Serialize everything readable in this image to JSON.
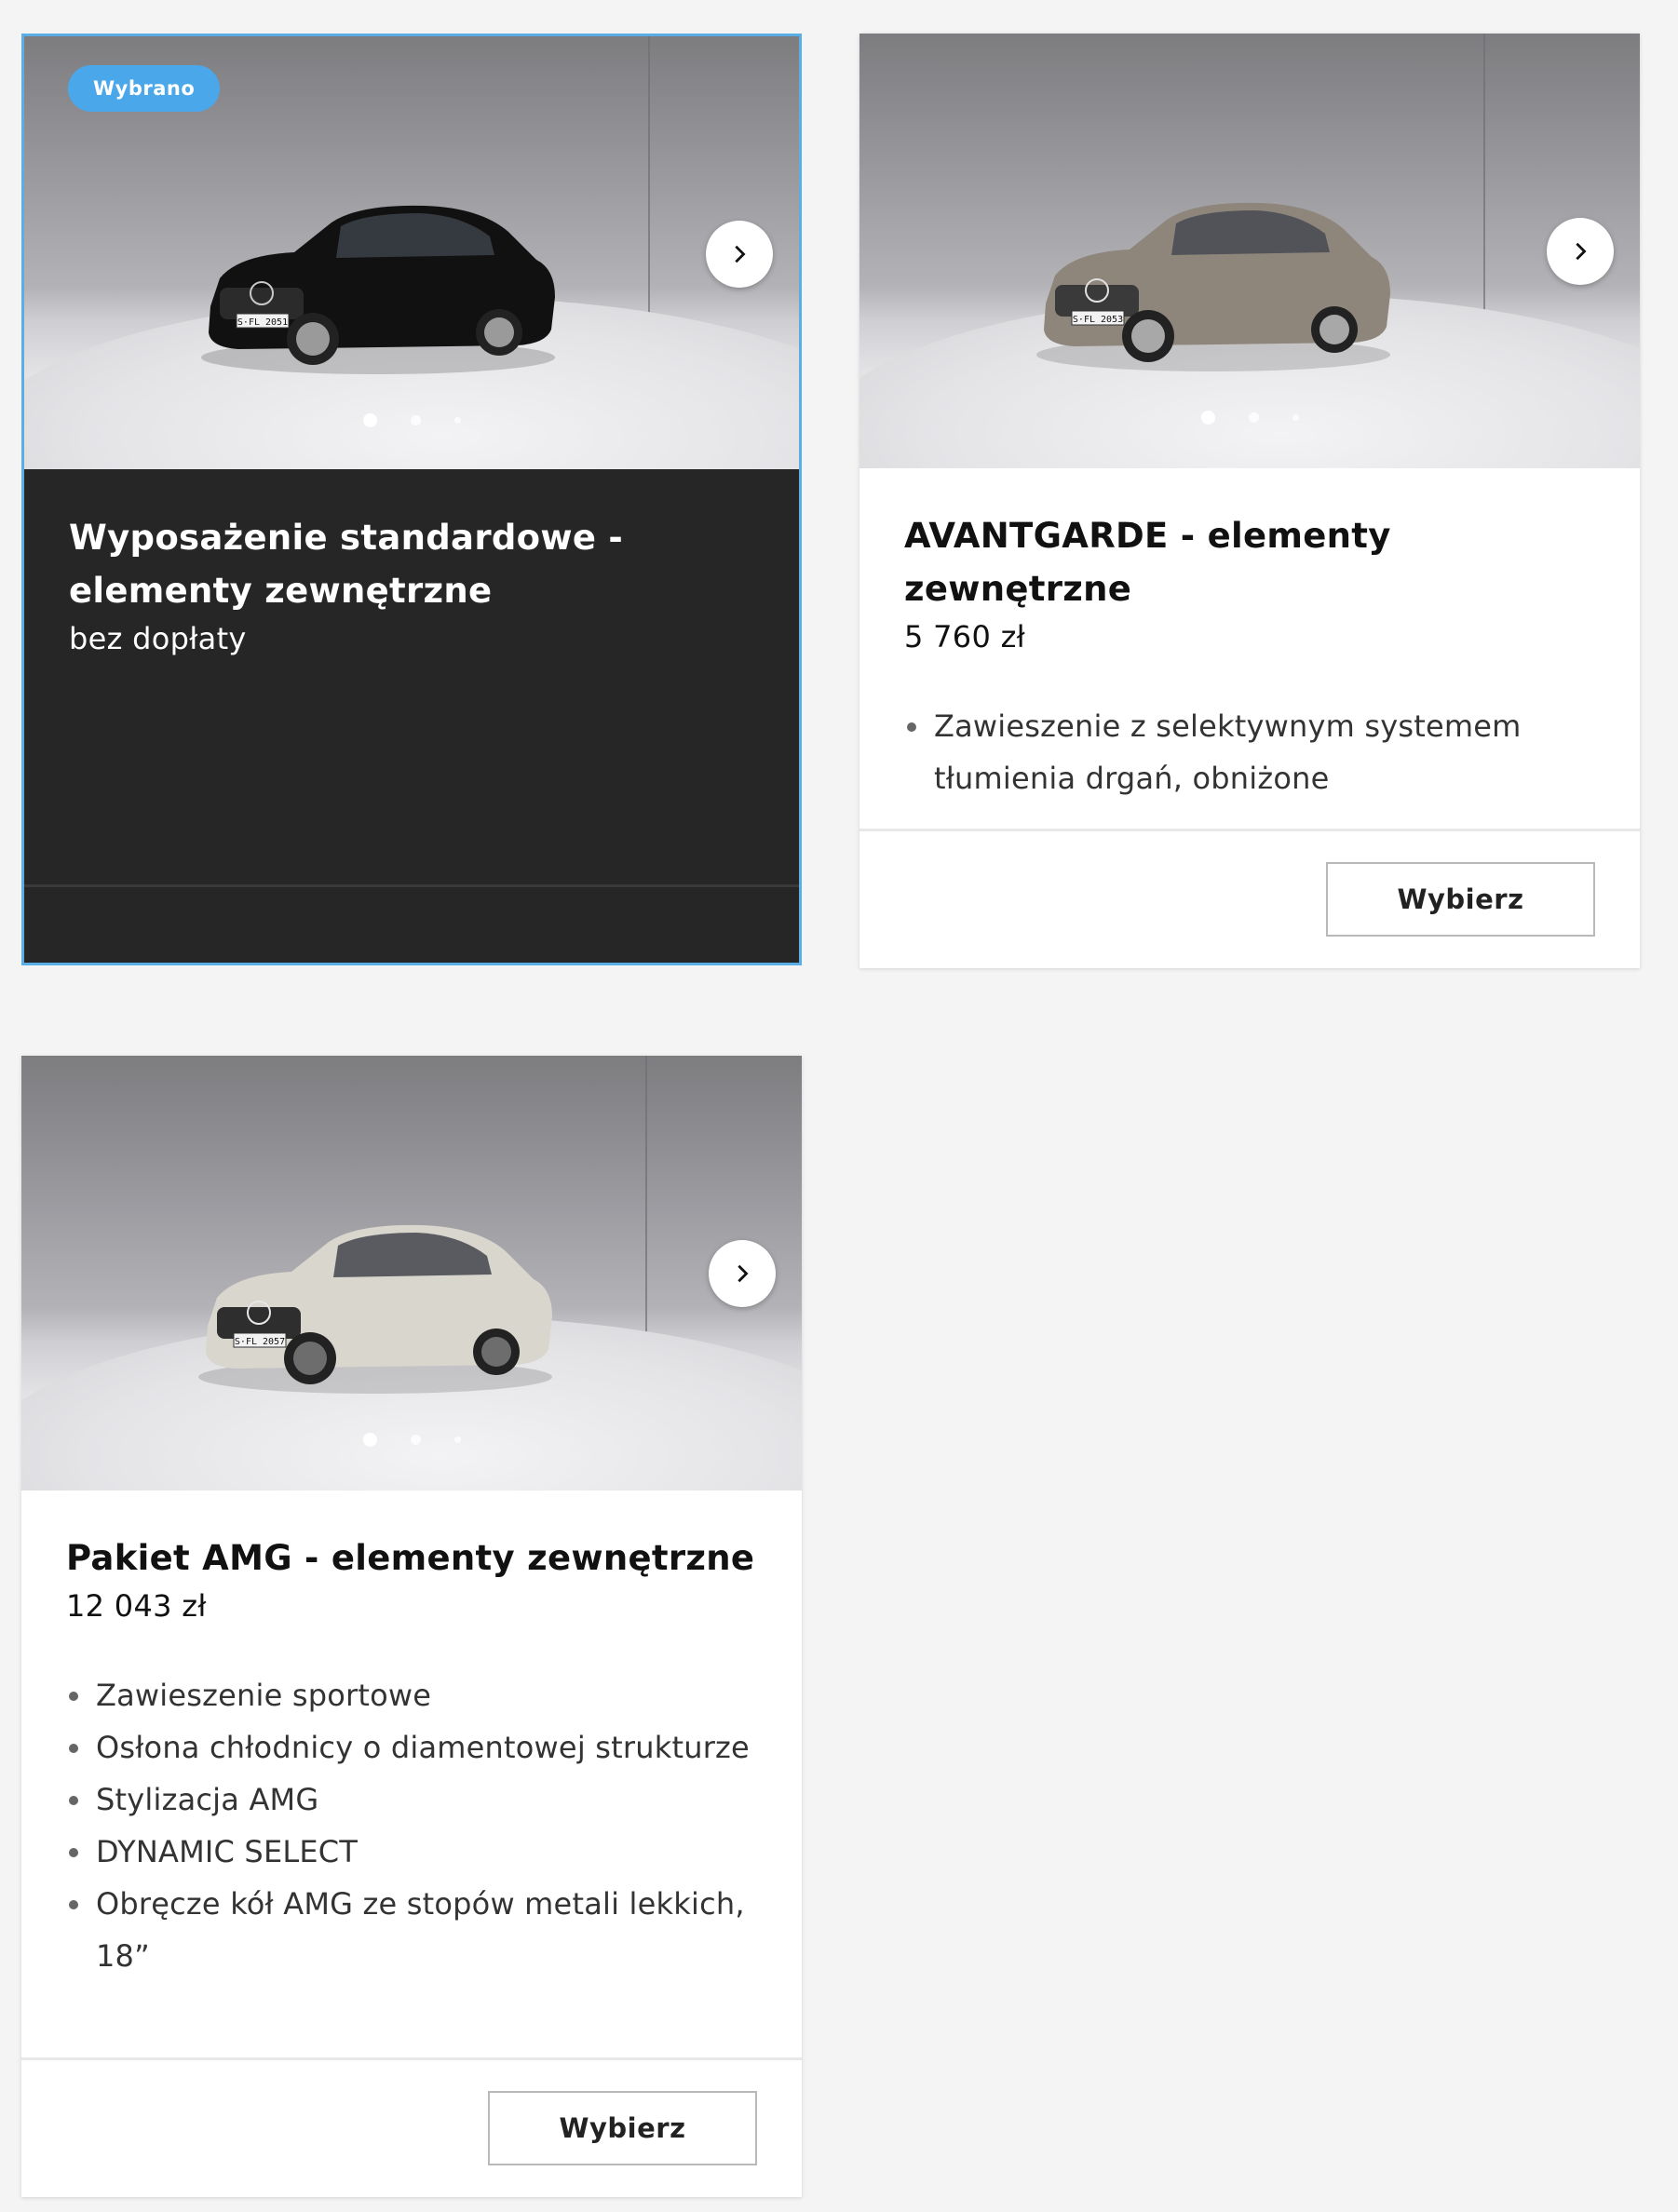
{
  "cards": [
    {
      "badge": "Wybrano",
      "title": "Wyposażenie standardowe - elementy zewnętrzne",
      "price": "bez dopłaty",
      "car_color": "#111111",
      "plate": "S-FL 2051",
      "features": []
    },
    {
      "title": "AVANTGARDE - elementy zewnętrzne",
      "price": "5 760 zł",
      "car_color": "#8e857b",
      "plate": "S-FL 2053",
      "features": [
        "Zawieszenie z selektywnym systemem tłumienia drgań, obniżone"
      ],
      "button_label": "Wybierz"
    },
    {
      "title": "Pakiet AMG - elementy zewnętrzne",
      "price": "12 043 zł",
      "car_color": "#d9d6ce",
      "plate": "S-FL 2057",
      "features": [
        "Zawieszenie sportowe",
        "Osłona chłodnicy o diamentowej strukturze",
        "Stylizacja AMG",
        "DYNAMIC SELECT",
        "Obręcze kół AMG ze stopów metali lekkich, 18”"
      ],
      "button_label": "Wybierz"
    }
  ],
  "colors": {
    "accent": "#4aa7ea",
    "selected_bg": "#262626",
    "page_bg": "#f4f4f4"
  },
  "icons": {
    "next": "chevron-right-icon"
  }
}
